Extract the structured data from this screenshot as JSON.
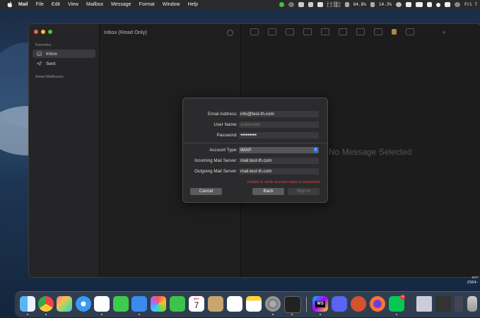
{
  "menubar": {
    "app": "Mail",
    "items": [
      "File",
      "Edit",
      "View",
      "Mailbox",
      "Message",
      "Format",
      "Window",
      "Help"
    ],
    "status": {
      "net_up": "2.4 KB/s",
      "net_down": "1.2 KB/s",
      "cpu": "64.8%",
      "mem": "14.3%",
      "clock": "Fri 7"
    }
  },
  "sidebar": {
    "favorites_header": "Favorites",
    "items": [
      {
        "label": "Inbox",
        "icon": "inbox-icon"
      },
      {
        "label": "Sent",
        "icon": "sent-icon"
      }
    ],
    "smart_header": "Smart Mailboxes"
  },
  "message_list": {
    "title": "Inbox (Read Only)"
  },
  "viewer": {
    "empty_text": "No Message Selected"
  },
  "dialog": {
    "email_label": "Email Address:",
    "email_value": "info@test-th.com",
    "username_label": "User Name:",
    "username_placeholder": "Automatic",
    "password_label": "Password:",
    "password_value": "●●●●●●●●●",
    "account_type_label": "Account Type:",
    "account_type_value": "IMAP",
    "incoming_label": "Incoming Mail Server:",
    "incoming_value": "mail.test-th.com",
    "outgoing_label": "Outgoing Mail Server:",
    "outgoing_value": "mail.test-th.com",
    "error": "Unable to verify account name or password.",
    "cancel": "Cancel",
    "back": "Back",
    "signin": "Sign In"
  },
  "dock": {
    "calendar_month": "MAY",
    "calendar_day": "7",
    "webstorm": "WS",
    "line_badge": "10",
    "right_labels": [
      "scr",
      "2564-"
    ]
  },
  "colors": {
    "error": "#e0453b",
    "accent": "#2f6fe0"
  }
}
